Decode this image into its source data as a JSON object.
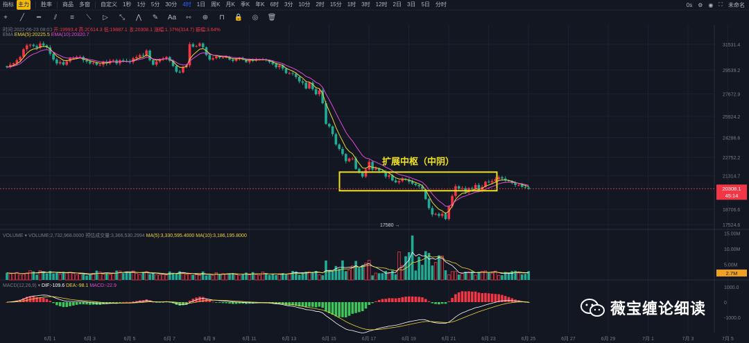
{
  "topbar": {
    "items": [
      "指标",
      "主力",
      "|",
      "胜率",
      "|",
      "商品",
      "多窗",
      "|",
      "自定义",
      "1秒",
      "1分",
      "5分",
      "30分",
      "4时",
      "1日",
      "周K",
      "月K",
      "季K",
      "年K",
      "6时",
      "3分",
      "10分",
      "2时",
      "15分",
      "1时",
      "3时",
      "12时",
      "2日",
      "3日",
      "5日",
      "分时"
    ],
    "active": "4时",
    "right": [
      "0s",
      "未命名"
    ]
  },
  "info_line": {
    "time": "时间:2022-06-23 08:00",
    "open": "开:19993.4",
    "high": "高:20614.3",
    "low": "低:19887.1",
    "close": "收:20308.1",
    "change": "涨幅:1.57%(314.7)",
    "amp": "振幅:3.64%"
  },
  "ema_line": {
    "label": "EMA",
    "ema5": "EMA(5):20225.5",
    "ema10": "EMA(10):20320.7"
  },
  "volume_line": {
    "label": "VOLUME",
    "volume": "VOLUME:2,732,968.0000",
    "est": "预估成交量:3,366,530.2994",
    "ma5": "MA(5):3,330,595.4000",
    "ma10": "MA(10):3,186,195.8000"
  },
  "macd_line": {
    "label": "MACD(12,26,9)",
    "dif": "DIF:-109.6",
    "dea": "DEA:-98.1",
    "macd": "MACD:-22.9"
  },
  "annotation": "扩展中枢（中阴）",
  "low_label": "17580",
  "last_price": "20308.1",
  "countdown": "45:14",
  "vol_last": "2.7M",
  "watermark": "薇宝缠论细读",
  "colors": {
    "up": "#f23645",
    "down": "#22ab94",
    "ema5": "#f0d43a",
    "ema10": "#e04bd6",
    "box": "#f0e020",
    "bg": "#131722"
  },
  "chart_data": {
    "type": "candlestick",
    "price_axis": {
      "ticks": [
        31531.4,
        29539.2,
        27672.9,
        25924.2,
        24286.6,
        22752.2,
        21314.7,
        18706.6,
        17524.6
      ],
      "labels": [
        "31531.4",
        "29539.2",
        "27672.9",
        "25924.2",
        "24286.6",
        "22752.2",
        "21314.7",
        "18706.6",
        "17524.6"
      ]
    },
    "volume_axis": {
      "ticks": [
        "15.00M",
        "10.00M",
        "5.00M"
      ]
    },
    "macd_axis": {
      "ticks": [
        "1000.0",
        "0",
        "-1000.0"
      ]
    },
    "x_labels": [
      "6月 1",
      "6月 3",
      "6月 5",
      "6月 7",
      "6月 9",
      "6月 11",
      "6月 13",
      "6月 15",
      "6月 17",
      "6月 19",
      "6月 21",
      "6月 23",
      "6月 25",
      "6月 27",
      "6月 29",
      "7月 1",
      "7月 3",
      "7月 5"
    ],
    "closes": [
      29750,
      29950,
      30050,
      30300,
      30550,
      31150,
      31450,
      31500,
      31400,
      31250,
      31600,
      31450,
      31300,
      30800,
      30350,
      30050,
      30150,
      29950,
      30200,
      30450,
      30450,
      30550,
      30550,
      30300,
      30200,
      30050,
      30100,
      29950,
      29950,
      30150,
      30050,
      30250,
      30300,
      30050,
      30300,
      30250,
      30200,
      30150,
      30450,
      30550,
      30700,
      30650,
      31050,
      30300,
      29950,
      30200,
      30350,
      30450,
      30550,
      30250,
      29850,
      29400,
      29350,
      29750,
      29900,
      31550,
      31350,
      31400,
      31600,
      31300,
      30700,
      30350,
      30450,
      30600,
      30500,
      30500,
      30550,
      30350,
      30250,
      30400,
      30450,
      30350,
      30150,
      30350,
      30250,
      30350,
      30350,
      30350,
      30300,
      30150,
      30000,
      29750,
      29900,
      29650,
      29300,
      29300,
      29250,
      29000,
      28650,
      28550,
      28100,
      28550,
      28050,
      27650,
      27950,
      26950,
      25350,
      25150,
      24550,
      23750,
      23400,
      23000,
      22450,
      22650,
      22650,
      21850,
      21550,
      21250,
      21800,
      22400,
      21800,
      21900,
      21700,
      21650,
      21250,
      21350,
      20950,
      20800,
      20900,
      21050,
      21000,
      20850,
      20700,
      20600,
      20500,
      20250,
      19500,
      18800,
      18300,
      18350,
      18200,
      18350,
      17950,
      18950,
      19750,
      20500,
      20300,
      20350,
      20050,
      20350,
      20250,
      20600,
      20200,
      20450,
      20850,
      20800,
      20900,
      21050,
      21200,
      21100,
      20950,
      20900,
      20750,
      20600,
      20600,
      20450,
      20400,
      20308
    ],
    "low_value": 17580,
    "annotation_box": {
      "x_from": "6月 15",
      "x_to": "6月 23",
      "price_high": 21600,
      "price_low": 20150
    },
    "last_price": 20308.1
  }
}
